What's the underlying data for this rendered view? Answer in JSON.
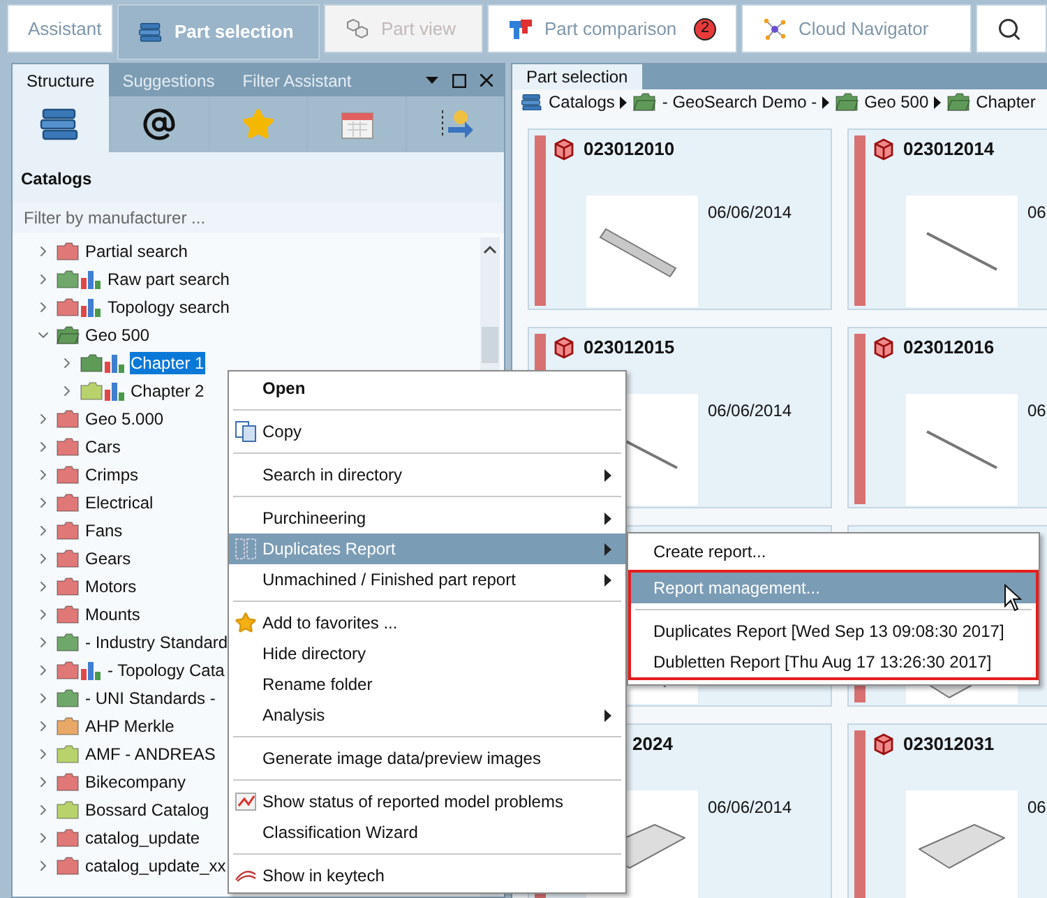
{
  "top_tabs": [
    {
      "label": "Assistant",
      "selected": false,
      "disabled": false
    },
    {
      "label": "Part selection",
      "selected": true,
      "disabled": false
    },
    {
      "label": "Part view",
      "selected": false,
      "disabled": true
    },
    {
      "label": "Part comparison",
      "selected": false,
      "disabled": false,
      "badge": "2"
    },
    {
      "label": "Cloud Navigator",
      "selected": false,
      "disabled": false
    }
  ],
  "left_panel": {
    "tabs": [
      {
        "label": "Structure",
        "selected": true
      },
      {
        "label": "Suggestions",
        "selected": false
      },
      {
        "label": "Filter Assistant",
        "selected": false
      }
    ],
    "icon_tabs": [
      {
        "selected": true
      },
      {
        "selected": false
      },
      {
        "selected": false
      },
      {
        "selected": false
      },
      {
        "selected": false
      }
    ],
    "heading": "Catalogs",
    "filter": {
      "placeholder": "Filter by manufacturer ..."
    },
    "tree": {
      "items": [
        {
          "children": [
            {
              "label": "Partial search",
              "kind": "folder",
              "color": "#e07878",
              "expanded": false,
              "selected": false
            },
            {
              "label": "Raw part search",
              "kind": "folder-chart",
              "color": "#6fa86a",
              "expanded": false,
              "selected": false
            },
            {
              "label": "Topology search",
              "kind": "folder-chart",
              "color": "#e07878",
              "expanded": false,
              "selected": false
            },
            {
              "label": "Geo 500",
              "kind": "folder",
              "color": "#5f9a58",
              "expanded": true,
              "selected": false,
              "children": [
                {
                  "label": "Chapter 1",
                  "kind": "folder-chart",
                  "color": "#5f9a58",
                  "expanded": false,
                  "selected": true
                },
                {
                  "label": "Chapter 2",
                  "kind": "folder-chart",
                  "color": "#b8d26c",
                  "expanded": false,
                  "selected": false
                }
              ]
            },
            {
              "label": "Geo 5.000",
              "kind": "folder",
              "color": "#e07878",
              "expanded": false,
              "selected": false
            },
            {
              "label": "Cars",
              "kind": "folder",
              "color": "#e07878",
              "expanded": false,
              "selected": false
            },
            {
              "label": "Crimps",
              "kind": "folder",
              "color": "#e07878",
              "expanded": false,
              "selected": false
            },
            {
              "label": "Electrical",
              "kind": "folder",
              "color": "#e07878",
              "expanded": false,
              "selected": false
            },
            {
              "label": "Fans",
              "kind": "folder",
              "color": "#e07878",
              "expanded": false,
              "selected": false
            },
            {
              "label": "Gears",
              "kind": "folder",
              "color": "#e07878",
              "expanded": false,
              "selected": false
            },
            {
              "label": "Motors",
              "kind": "folder",
              "color": "#e07878",
              "expanded": false,
              "selected": false
            },
            {
              "label": "Mounts",
              "kind": "folder",
              "color": "#e07878",
              "expanded": false,
              "selected": false
            }
          ]
        },
        {
          "label": "- Industry Standard",
          "kind": "folder",
          "color": "#6fa86a",
          "expanded": false,
          "selected": false
        },
        {
          "label": "- Topology Cata",
          "kind": "folder-chart",
          "color": "#e07878",
          "expanded": false,
          "selected": false
        },
        {
          "label": "- UNI Standards -",
          "kind": "folder",
          "color": "#6fa86a",
          "expanded": false,
          "selected": false
        },
        {
          "label": "AHP Merkle",
          "kind": "folder",
          "color": "#e8a868",
          "expanded": false,
          "selected": false
        },
        {
          "label": "AMF - ANDREAS",
          "kind": "folder",
          "color": "#b8d26c",
          "expanded": false,
          "selected": false
        },
        {
          "label": "Bikecompany",
          "kind": "folder",
          "color": "#e07878",
          "expanded": false,
          "selected": false
        },
        {
          "label": "Bossard Catalog",
          "kind": "folder",
          "color": "#b8d26c",
          "expanded": false,
          "selected": false
        },
        {
          "label": "catalog_update",
          "kind": "folder",
          "color": "#e07878",
          "expanded": false,
          "selected": false
        },
        {
          "label": "catalog_update_xx",
          "kind": "folder",
          "color": "#e07878",
          "expanded": false,
          "selected": false
        }
      ]
    }
  },
  "right_panel": {
    "tab": {
      "label": "Part selection",
      "selected": true
    },
    "breadcrumb": [
      "Catalogs",
      "- GeoSearch Demo -",
      "Geo 500",
      "Chapter"
    ],
    "cards": [
      {
        "kind": "part",
        "title": "023012010",
        "date": "06/06/2014"
      },
      {
        "kind": "part",
        "title": "023012014",
        "date": "06"
      },
      {
        "kind": "part",
        "title": "023012015",
        "date": "06/06/2014"
      },
      {
        "kind": "part",
        "title": "023012016",
        "date": "06"
      },
      {
        "kind": "part"
      },
      {
        "kind": "part"
      },
      {
        "kind": "part",
        "title": "2024",
        "date": "06/06/2014",
        "title_clipped": true
      },
      {
        "kind": "part",
        "title": "023012031",
        "date": "06"
      }
    ]
  },
  "context_menu": {
    "items": [
      {
        "kind": "item",
        "label": "Open",
        "default": true,
        "submenu": false,
        "highlighted": false
      },
      {
        "kind": "separator"
      },
      {
        "kind": "item",
        "label": "Copy",
        "default": false,
        "submenu": false,
        "highlighted": false
      },
      {
        "kind": "separator"
      },
      {
        "kind": "item",
        "label": "Search in directory",
        "default": false,
        "submenu": true,
        "highlighted": false
      },
      {
        "kind": "separator"
      },
      {
        "kind": "item",
        "label": "Purchineering",
        "default": false,
        "submenu": true,
        "highlighted": false
      },
      {
        "kind": "item",
        "label": "Duplicates Report",
        "default": false,
        "submenu": true,
        "highlighted": true
      },
      {
        "kind": "item",
        "label": "Unmachined / Finished part report",
        "default": false,
        "submenu": true,
        "highlighted": false
      },
      {
        "kind": "separator"
      },
      {
        "kind": "item",
        "label": "Add to favorites ...",
        "default": false,
        "submenu": false,
        "highlighted": false
      },
      {
        "kind": "item",
        "label": "Hide directory",
        "default": false,
        "submenu": false,
        "highlighted": false
      },
      {
        "kind": "item",
        "label": "Rename folder",
        "default": false,
        "submenu": false,
        "highlighted": false
      },
      {
        "kind": "item",
        "label": "Analysis",
        "default": false,
        "submenu": true,
        "highlighted": false
      },
      {
        "kind": "separator"
      },
      {
        "kind": "item",
        "label": "Generate image data/preview images",
        "default": false,
        "submenu": false,
        "highlighted": false
      },
      {
        "kind": "separator"
      },
      {
        "kind": "item",
        "label": "Show status of reported model problems",
        "default": false,
        "submenu": false,
        "highlighted": false
      },
      {
        "kind": "item",
        "label": "Classification Wizard",
        "default": false,
        "submenu": false,
        "highlighted": false
      },
      {
        "kind": "separator"
      },
      {
        "kind": "item",
        "label": "Show in keytech",
        "default": false,
        "submenu": false,
        "highlighted": false
      }
    ]
  },
  "submenu": {
    "items": [
      {
        "kind": "item",
        "label": "Create report...",
        "highlighted": false,
        "framed": false
      },
      {
        "kind": "item",
        "label": "Report management...",
        "highlighted": true,
        "framed": true
      },
      {
        "kind": "separator",
        "framed": true
      },
      {
        "kind": "item",
        "label": "Duplicates Report [Wed Sep 13 09:08:30 2017]",
        "highlighted": false,
        "framed": true
      },
      {
        "kind": "item",
        "label": "Dubletten Report [Thu Aug 17 13:26:30 2017]",
        "highlighted": false,
        "framed": true
      }
    ]
  }
}
